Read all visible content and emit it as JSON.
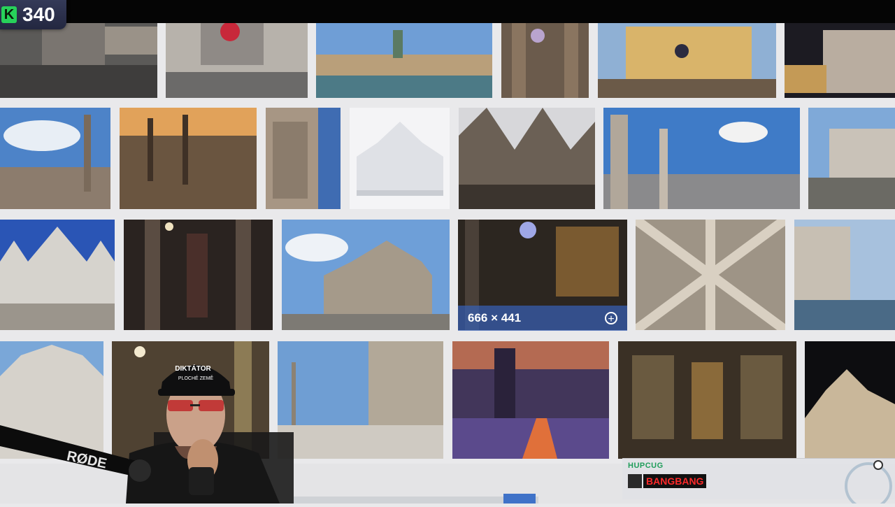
{
  "viewer_count": {
    "prefix": "K",
    "value": "340"
  },
  "image_results": {
    "hover_dimensions": "666 × 441",
    "hover_action_icon": "zoom-plus-icon",
    "rows": 4
  },
  "chat": {
    "username": "HUPCUG",
    "message": "BANGBANG"
  },
  "webcam": {
    "cap_text_top": "DIKTÁTOR",
    "cap_text_bottom": "PLOCHÉ ZEMĚ",
    "mic_brand": "RØDE"
  },
  "colors": {
    "accent_green": "#27d15a",
    "overlay_blue": "#3f72c8",
    "chat_red": "#ff2a2a"
  }
}
